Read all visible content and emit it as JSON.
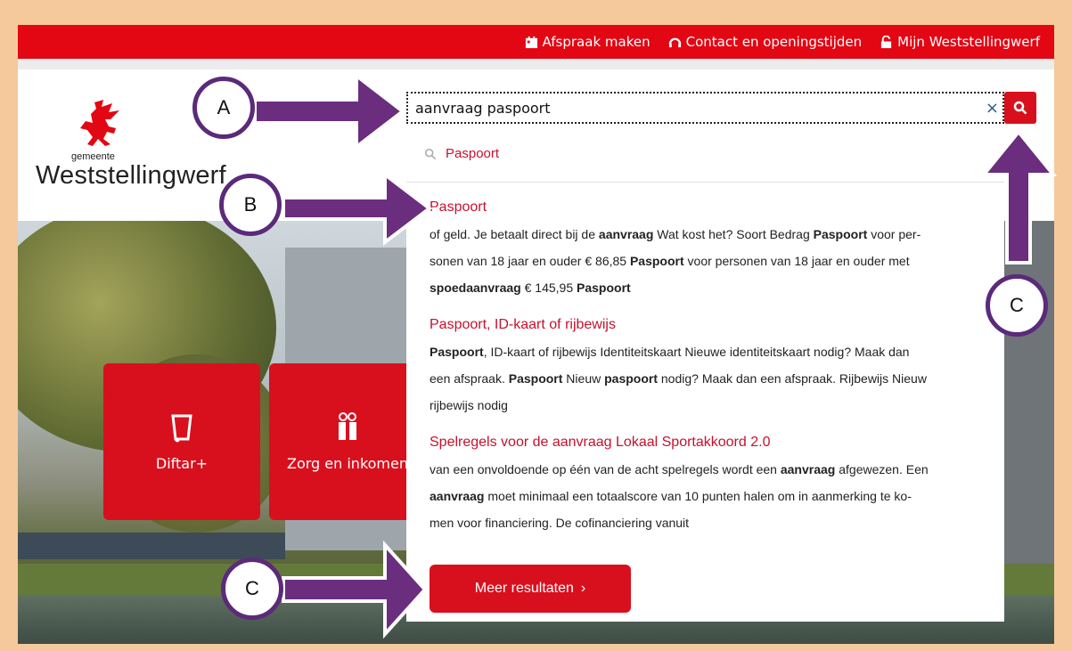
{
  "topbar": {
    "links": [
      {
        "label": "Afspraak maken",
        "icon": "calendar-icon"
      },
      {
        "label": "Contact en openingstijden",
        "icon": "headset-icon"
      },
      {
        "label": "Mijn Weststellingwerf",
        "icon": "lock-icon"
      }
    ]
  },
  "logo": {
    "small": "gemeente",
    "big": "Weststellingwerf"
  },
  "search": {
    "value": "aanvraag paspoort",
    "clear": "×"
  },
  "suggestion": {
    "label": "Paspoort"
  },
  "results": [
    {
      "title": "Paspoort"
    },
    {
      "title": "Paspoort, ID-kaart of rijbewijs"
    },
    {
      "title": "Spelregels voor de aanvraag Lokaal Sportakkoord 2.0"
    }
  ],
  "more_button": "Meer resultaten",
  "tiles": [
    {
      "label": "Diftar+",
      "icon": "trash-bin-icon"
    },
    {
      "label": "Zorg en inkomen",
      "icon": "people-icon"
    }
  ],
  "annotations": {
    "a": "A",
    "b": "B",
    "c1": "C",
    "c2": "C"
  },
  "colors": {
    "brand_red": "#e30613",
    "annotation_purple": "#5b2a7a",
    "frame": "#f5c99b"
  }
}
